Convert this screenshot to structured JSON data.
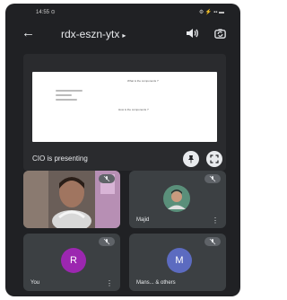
{
  "status_bar": {
    "time": "14:55 ⊙",
    "indicators": "⚙ ⚡ ▪▪ ▬"
  },
  "header": {
    "back_icon": "arrow-back-icon",
    "meeting_code": "rdx-eszn-ytx",
    "chevron": "▸"
  },
  "presentation": {
    "slide": {
      "question_1": "What is the components ?",
      "question_2": "How is the components ?"
    },
    "presenter_label": "CIO is presenting"
  },
  "participants": [
    {
      "name": "",
      "type": "camera"
    },
    {
      "name": "Majid",
      "type": "photo"
    },
    {
      "name": "You",
      "type": "letter",
      "letter": "R",
      "color": "#9c27b0"
    },
    {
      "name": "Mans... & others",
      "type": "letter",
      "letter": "M",
      "color": "#5c6bc0"
    }
  ],
  "colors": {
    "background": "#202124",
    "tile": "#3c4043"
  }
}
